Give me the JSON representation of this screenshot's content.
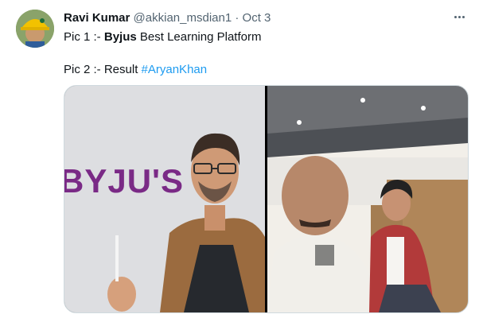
{
  "tweet": {
    "author_name": "Ravi Kumar",
    "handle": "@akkian_msdian1",
    "separator": "·",
    "date": "Oct 3",
    "line1_prefix": "Pic 1 :- ",
    "line1_bold": "Byjus",
    "line1_suffix": " Best Learning Platform",
    "line2_prefix": "Pic 2 :- Result ",
    "line2_hashtag": "#AryanKhan"
  },
  "media": {
    "pic1_brand_text": "BYJU'S",
    "pic1_description": "man in glasses and brown jacket in front of a BYJU'S backdrop",
    "pic2_description": "selfie of two men in an office"
  },
  "icons": [
    "more-options-icon",
    "avatar"
  ],
  "colors": {
    "hashtag": "#1d9bf0",
    "secondary_text": "#536471",
    "brand_purple": "#7a2a86"
  }
}
